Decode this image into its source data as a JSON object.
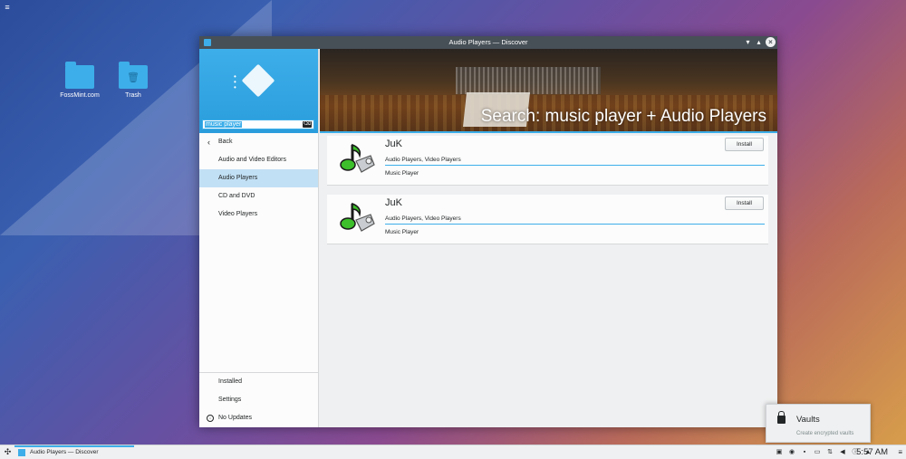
{
  "desktop": {
    "icons": [
      {
        "label": "FossMint.com"
      },
      {
        "label": "Trash"
      }
    ]
  },
  "window": {
    "title": "Audio Players — Discover",
    "search": {
      "value": "music player"
    },
    "sidebar": {
      "back_label": "Back",
      "items": [
        {
          "label": "Audio and Video Editors"
        },
        {
          "label": "Audio Players"
        },
        {
          "label": "CD and DVD"
        },
        {
          "label": "Video Players"
        }
      ],
      "bottom": [
        {
          "label": "Installed"
        },
        {
          "label": "Settings"
        },
        {
          "label": "No Updates"
        }
      ]
    },
    "banner": {
      "headline": "Search: music player + Audio Players"
    },
    "results": [
      {
        "name": "JuK",
        "categories": "Audio Players, Video Players",
        "description": "Music Player",
        "button": "Install"
      },
      {
        "name": "JuK",
        "categories": "Audio Players, Video Players",
        "description": "Music Player",
        "button": "Install"
      }
    ]
  },
  "notification": {
    "title": "Vaults",
    "subtitle": "Create encrypted vaults"
  },
  "taskbar": {
    "task_label": "Audio Players — Discover",
    "clock": "5:57 AM"
  },
  "colors": {
    "accent": "#3daee9",
    "titlebar": "#475057"
  }
}
